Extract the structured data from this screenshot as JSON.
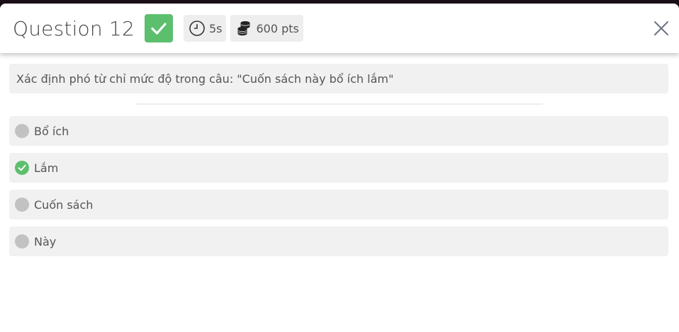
{
  "header": {
    "title": "Question 12",
    "status_icon": "check-icon",
    "time": "5s",
    "points": "600 pts",
    "close_icon": "close-icon"
  },
  "question": {
    "text": "Xác định phó từ chỉ mức độ trong câu: \"Cuốn sách này bổ ích lắm\""
  },
  "options": [
    {
      "label": "Bổ ích",
      "state": "neutral"
    },
    {
      "label": "Lắm",
      "state": "correct"
    },
    {
      "label": "Cuốn sách",
      "state": "neutral"
    },
    {
      "label": "Này",
      "state": "neutral"
    }
  ],
  "colors": {
    "correct": "#5cbf6e",
    "neutral_radio": "#c2c2c2",
    "panel": "#f1f1f1",
    "text": "#555555"
  }
}
